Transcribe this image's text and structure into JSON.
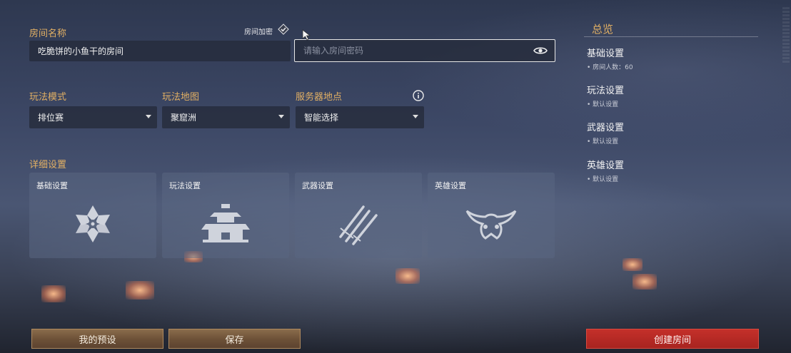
{
  "room_name": {
    "label": "房间名称",
    "value": "吃脆饼的小鱼干的房间",
    "encrypt_label": "房间加密",
    "encrypt_checked": true
  },
  "password": {
    "placeholder": "请输入房间密码",
    "eye_icon": "eye-icon"
  },
  "mode": {
    "label": "玩法模式",
    "value": "排位赛"
  },
  "map": {
    "label": "玩法地图",
    "value": "聚窟洲"
  },
  "server": {
    "label": "服务器地点",
    "value": "智能选择",
    "info_icon": "info-icon"
  },
  "detail": {
    "label": "详细设置",
    "cards": [
      {
        "title": "基础设置",
        "icon": "snowflake-flower-icon"
      },
      {
        "title": "玩法设置",
        "icon": "palace-icon"
      },
      {
        "title": "武器设置",
        "icon": "swords-icon"
      },
      {
        "title": "英雄设置",
        "icon": "mask-icon"
      }
    ]
  },
  "overview": {
    "title": "总览",
    "sections": [
      {
        "heading": "基础设置",
        "sub": "• 房间人数：60"
      },
      {
        "heading": "玩法设置",
        "sub": "• 默认设置"
      },
      {
        "heading": "武器设置",
        "sub": "• 默认设置"
      },
      {
        "heading": "英雄设置",
        "sub": "• 默认设置"
      }
    ]
  },
  "buttons": {
    "presets": "我的预设",
    "save": "保存",
    "create": "创建房间"
  },
  "colors": {
    "accent_gold": "#e2b064",
    "create_red": "#c4302a",
    "wood": "#6e5238"
  }
}
